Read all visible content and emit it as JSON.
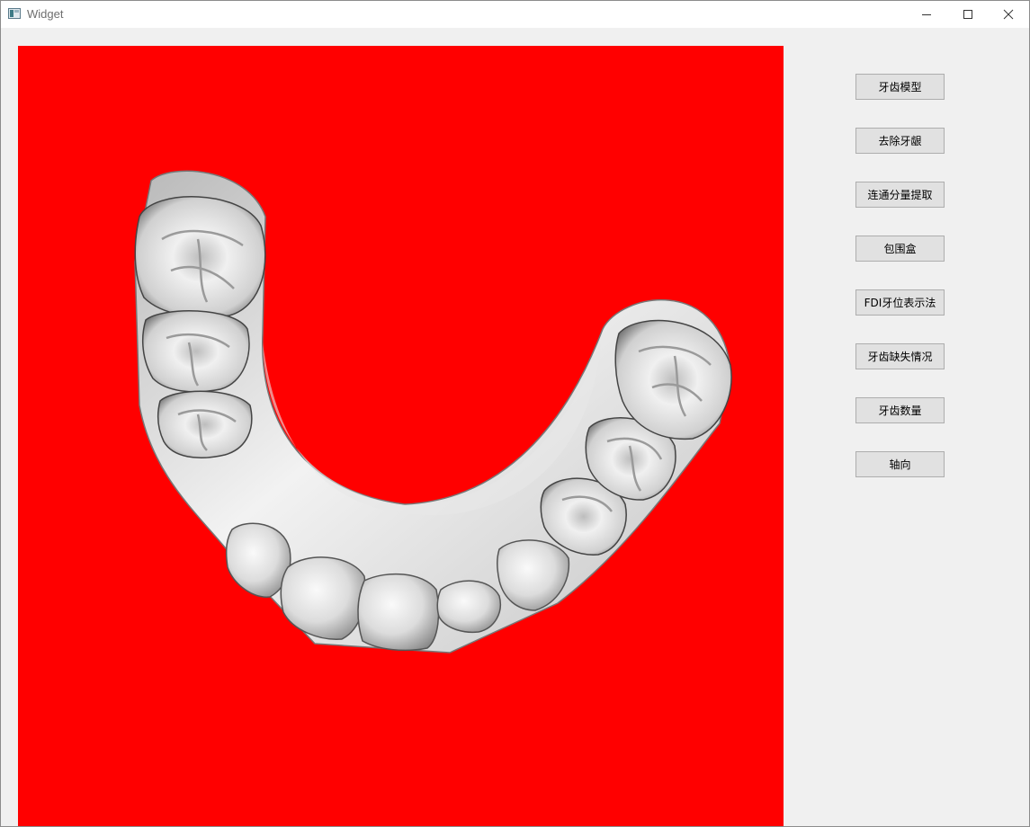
{
  "window": {
    "title": "Widget"
  },
  "colors": {
    "viewport_background": "#ff0000",
    "button_face": "#e1e1e1",
    "button_border": "#adadad"
  },
  "viewport": {
    "model": "dental-arch-mesh"
  },
  "sidebar": {
    "buttons": [
      {
        "label": "牙齿模型"
      },
      {
        "label": "去除牙龈"
      },
      {
        "label": "连通分量提取"
      },
      {
        "label": "包围盒"
      },
      {
        "label": "FDI牙位表示法"
      },
      {
        "label": "牙齿缺失情况"
      },
      {
        "label": "牙齿数量"
      },
      {
        "label": "轴向"
      }
    ]
  }
}
